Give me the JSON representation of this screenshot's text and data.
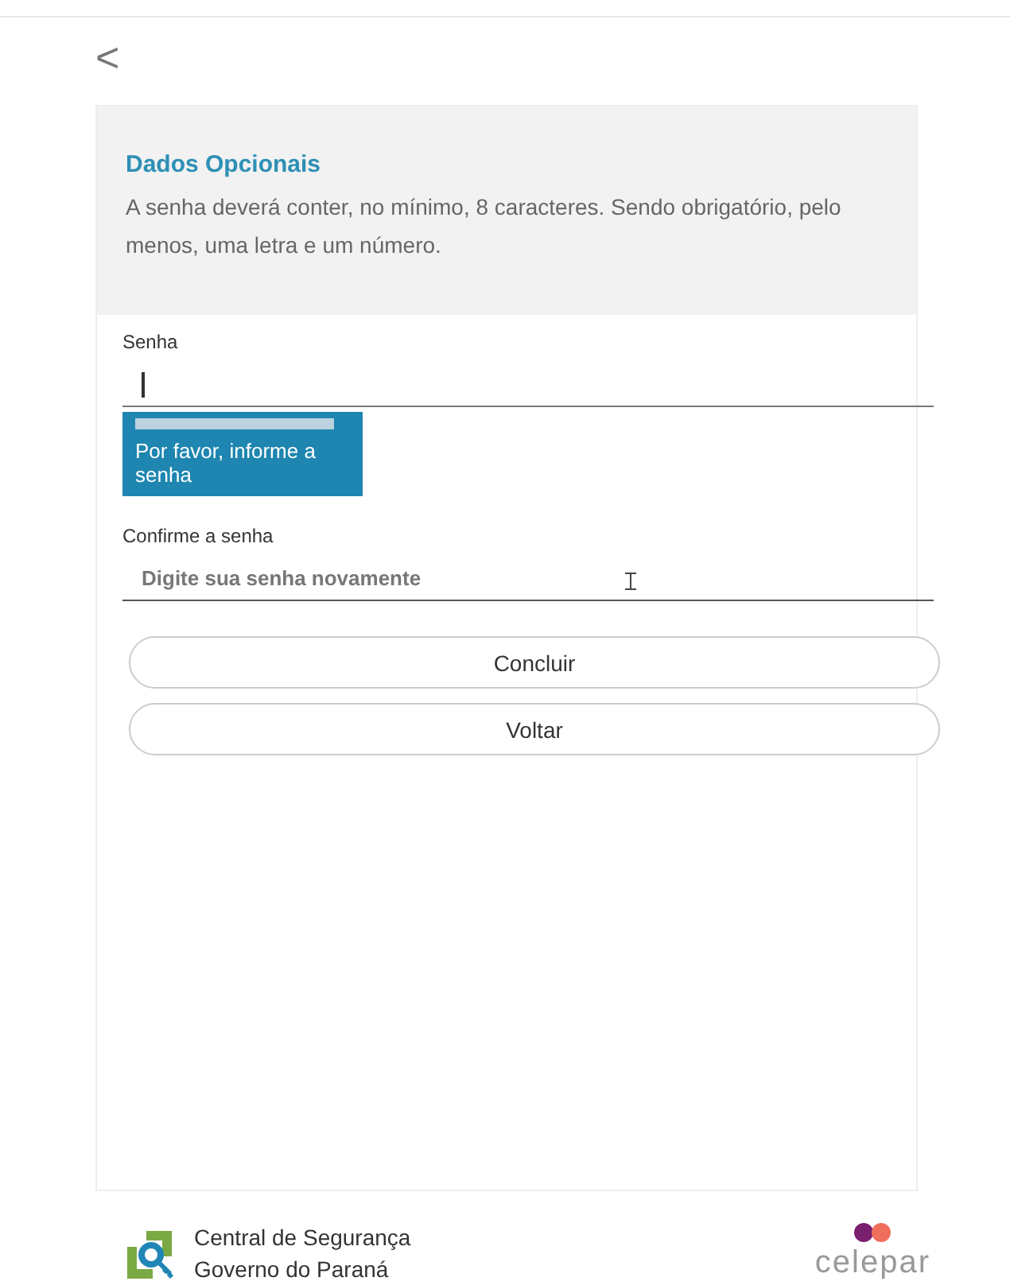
{
  "back_button": {
    "label": "<"
  },
  "header": {
    "title": "Dados Opcionais",
    "description": "A senha deverá conter, no mínimo, 8 caracteres. Sendo obrigatório, pelo menos, uma letra e um número."
  },
  "fields": [
    {
      "label": "Senha",
      "focused": true,
      "tooltip": "Por favor, informe a senha"
    },
    {
      "label": "Confirme a senha",
      "placeholder": "Digite sua senha novamente",
      "focused": false
    }
  ],
  "buttons": [
    "Concluir",
    "Voltar"
  ],
  "footer": {
    "brand_lines": [
      "Central de Segurança",
      "Governo do Paraná"
    ],
    "partner": "celepar"
  }
}
